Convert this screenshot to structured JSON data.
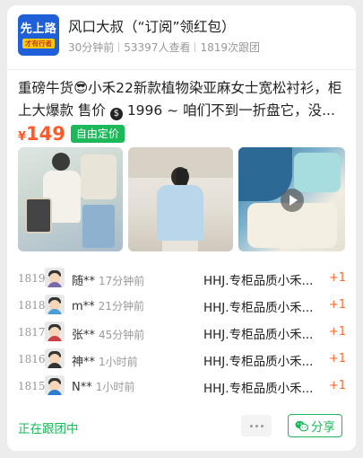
{
  "group": {
    "logo_line1": "先上路",
    "logo_line2": "才有行者",
    "title": "风口大叔（“订阅”领红包）",
    "time_ago": "30分钟前",
    "views": "53397人查看",
    "follows": "1819次跟团"
  },
  "post": {
    "desc_part1": "重磅牛货😎小禾22新款植物染亚麻女士宽松衬衫，柜上大爆款 售价",
    "desc_moneybag": "$",
    "desc_part2": "1996 ~ 咱们不到一折盘它，没...",
    "price_currency": "¥",
    "price_value": "149",
    "price_tag": "自由定价"
  },
  "media": {
    "play_icon": "play-icon"
  },
  "participants": [
    {
      "seq": "1819",
      "name": "随**",
      "time": "17分钟前",
      "product": "HHJ.专柜品质小禾...",
      "qty": "+1",
      "body_color": "#7a6aa8"
    },
    {
      "seq": "1818",
      "name": "m**",
      "time": "21分钟前",
      "product": "HHJ.专柜品质小禾...",
      "qty": "+1",
      "body_color": "#4a9fd8"
    },
    {
      "seq": "1817",
      "name": "张**",
      "time": "45分钟前",
      "product": "HHJ.专柜品质小禾...",
      "qty": "+1",
      "body_color": "#c94040"
    },
    {
      "seq": "1816",
      "name": "神**",
      "time": "1小时前",
      "product": "HHJ.专柜品质小禾...",
      "qty": "+1",
      "body_color": "#333333"
    },
    {
      "seq": "1815",
      "name": "N**",
      "time": "1小时前",
      "product": "HHJ.专柜品质小禾...",
      "qty": "+1",
      "body_color": "#2f7fd0"
    }
  ],
  "footer": {
    "status": "正在跟团中",
    "share_label": "分享",
    "more_icon": "more-dots-icon",
    "share_icon": "wechat-icon"
  },
  "colors": {
    "accent_green": "#1bb95a",
    "price_orange": "#ff5a2a"
  }
}
